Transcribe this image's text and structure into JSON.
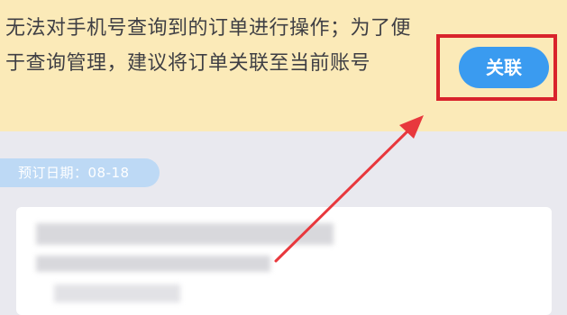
{
  "notice": {
    "text": "无法对手机号查询到的订单进行操作；为了便于查询管理，建议将订单关联至当前账号",
    "link_button_label": "关联"
  },
  "order": {
    "date_badge": "预订日期：08-18"
  },
  "colors": {
    "banner_background": "#fbeab8",
    "button_blue": "#3a9bf0",
    "highlight_red": "#d9232b",
    "badge_blue": "#bdd9f5"
  }
}
